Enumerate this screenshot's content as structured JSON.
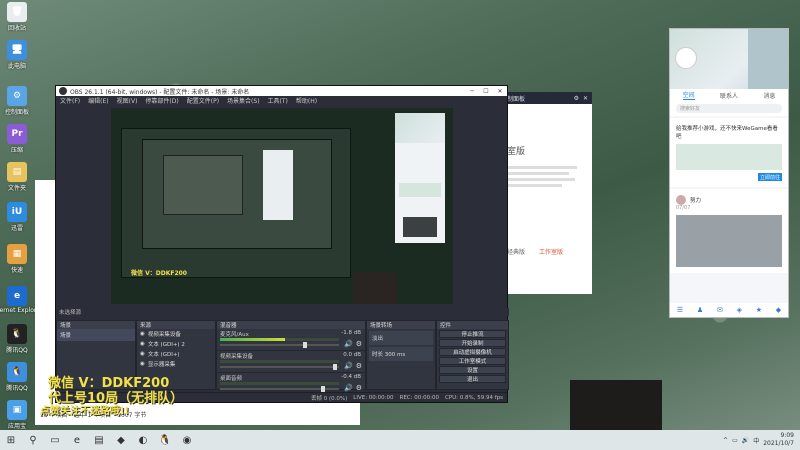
{
  "desktop_icons": [
    {
      "label": "回收站",
      "color": "#e9edf0",
      "glyph": "🗑"
    },
    {
      "label": "此电脑",
      "color": "#3d8fe0",
      "glyph": "🖥"
    },
    {
      "label": "控制面板",
      "color": "#5aa5e5",
      "glyph": "⚙"
    },
    {
      "label": "压缩",
      "color": "#8b5cd6",
      "glyph": "Pr"
    },
    {
      "label": "文件夹",
      "color": "#e6c35c",
      "glyph": "▤"
    },
    {
      "label": "迅雷",
      "color": "#2d8be0",
      "glyph": "iU"
    },
    {
      "label": "快速",
      "color": "#e6a040",
      "glyph": "▦"
    },
    {
      "label": "Internet Explorer",
      "color": "#1b6bd1",
      "glyph": "e"
    },
    {
      "label": "腾讯QQ",
      "color": "#222",
      "glyph": "🐧"
    },
    {
      "label": "腾讯QQ",
      "color": "#3d8fe0",
      "glyph": "🐧"
    },
    {
      "label": "应用宝",
      "color": "#4aa0e8",
      "glyph": "▣"
    },
    {
      "label": "NVIDIA RTX Voice",
      "color": "#222",
      "glyph": "🎧"
    }
  ],
  "obs": {
    "title": "OBS 26.1.1 (64-bit, windows) - 配置文件: 未命名 - 场景: 未命名",
    "menu": [
      "文件(F)",
      "编辑(E)",
      "视图(V)",
      "停靠部件(D)",
      "配置文件(P)",
      "场景集合(S)",
      "工具(T)",
      "帮助(H)"
    ],
    "preview_label": "未选择源",
    "docks": {
      "scenes": {
        "title": "场景",
        "items": [
          "场景"
        ]
      },
      "sources": {
        "title": "来源",
        "items": [
          "视频采集设备",
          "文本 (GDI+) 2",
          "文本 (GDI+)",
          "显示器采集"
        ]
      },
      "mixer": {
        "title": "混音器",
        "tracks": [
          {
            "name": "麦克风/Aux",
            "db": "-1.8 dB",
            "level": 0.55,
            "volume": 0.7
          },
          {
            "name": "视频采集设备",
            "db": "0.0 dB",
            "level": 0.0,
            "volume": 0.95
          },
          {
            "name": "桌面音频",
            "db": "-0.4 dB",
            "level": 0.0,
            "volume": 0.85
          }
        ]
      },
      "transitions": {
        "title": "场景转场",
        "items": [
          "淡出",
          "时长 300 ms"
        ]
      },
      "controls": {
        "title": "控件",
        "buttons": [
          "停止推流",
          "开始录制",
          "启动虚拟摄像机",
          "工作室模式",
          "设置",
          "退出"
        ]
      }
    },
    "status": [
      "丢帧 0 (0.0%)",
      "LIVE: 00:00:00",
      "REC: 00:00:00",
      "CPU: 0.8%, 59.94 fps"
    ]
  },
  "overlay_texts": [
    {
      "text": "微信 V：DDKF200",
      "color": "#f1e14a"
    },
    {
      "text": "代上号10局（无排队）",
      "color": "#f1e14a"
    },
    {
      "text": "点赞关注不迷路哦!!",
      "color": "#f5e34c"
    }
  ],
  "explorer": {
    "status": [
      "18 个项目",
      "选中 1 个项目",
      "1007 字节"
    ]
  },
  "dialog": {
    "header": "控制面板",
    "heading": "室版",
    "links": [
      "经典版",
      "工作室版"
    ]
  },
  "qq": {
    "tabs": [
      "空间",
      "联系人",
      "消息"
    ],
    "search_placeholder": "搜索好友",
    "notice": "给我推荐小游戏，还不快来WeGame看看吧",
    "button": "立即前往",
    "user": "努力",
    "date": "07/07"
  },
  "taskbar": {
    "apps": [
      "⊞",
      "⚲",
      "▭",
      "e",
      "▤",
      "◆",
      "◐",
      "🐧",
      "◉"
    ],
    "tray": [
      "^",
      "▭",
      "🔊",
      "中"
    ],
    "time": "9:09",
    "date": "2021/10/7"
  }
}
